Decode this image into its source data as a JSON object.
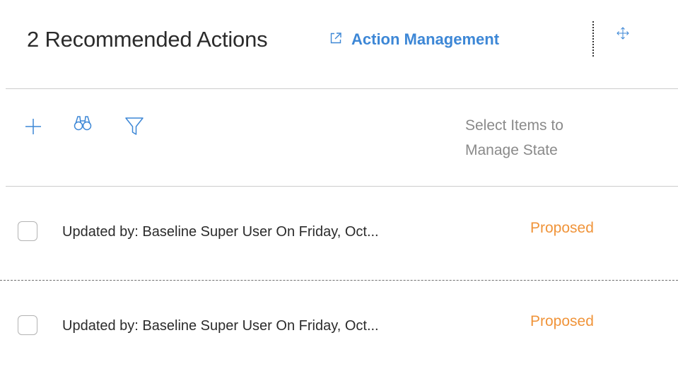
{
  "header": {
    "title": "2 Recommended Actions",
    "link_label": "Action Management",
    "link_icon": "external-link-icon",
    "move_icon": "move-icon",
    "accent_color": "#3d87d6"
  },
  "toolbar": {
    "add_icon": "plus-icon",
    "search_icon": "binoculars-icon",
    "filter_icon": "filter-icon",
    "hint_line1": "Select Items to",
    "hint_line2": "Manage State"
  },
  "rows": [
    {
      "text": "Updated by: Baseline Super User On  Friday, Oct...",
      "status": "Proposed",
      "status_color": "#f0943a"
    },
    {
      "text": "Updated by: Baseline Super User On  Friday, Oct...",
      "status": "Proposed",
      "status_color": "#f0943a"
    }
  ]
}
